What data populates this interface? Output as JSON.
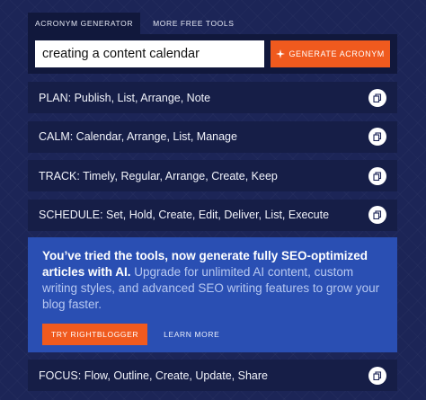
{
  "tabs": [
    {
      "label": "Acronym Generator",
      "active": true
    },
    {
      "label": "More Free Tools",
      "active": false
    }
  ],
  "search": {
    "value": "creating a content calendar",
    "button_label": "Generate Acronym",
    "button_icon": "sparkle-icon"
  },
  "results": [
    "PLAN: Publish, List, Arrange, Note",
    "CALM: Calendar, Arrange, List, Manage",
    "TRACK: Timely, Regular, Arrange, Create, Keep",
    "SCHEDULE: Set, Hold, Create, Edit, Deliver, List, Execute",
    "FOCUS: Flow, Outline, Create, Update, Share"
  ],
  "promo": {
    "headline": "You’ve tried the tools, now generate fully SEO-optimized articles with AI.",
    "body": "Upgrade for unlimited AI content, custom writing styles, and advanced SEO writing features to grow your blog faster.",
    "primary_label": "Try RightBlogger",
    "secondary_label": "Learn More"
  },
  "colors": {
    "background": "#1c2557",
    "accent": "#f05a1e",
    "promo": "#2a4fb3"
  }
}
